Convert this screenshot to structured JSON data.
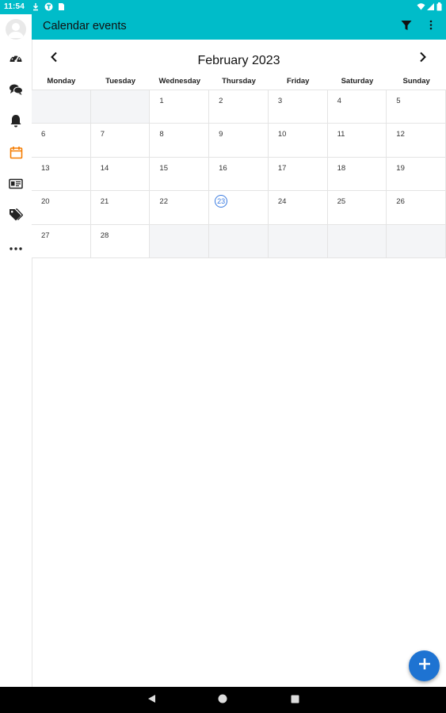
{
  "status_bar": {
    "time": "11:54",
    "icons": [
      "download-icon",
      "vpn-icon",
      "sim-icon",
      "wifi-icon",
      "signal-icon",
      "battery-icon"
    ]
  },
  "sidebar": {
    "items": [
      {
        "name": "avatar"
      },
      {
        "name": "dashboard-icon"
      },
      {
        "name": "chat-icon"
      },
      {
        "name": "bell-icon"
      },
      {
        "name": "calendar-icon",
        "active": true
      },
      {
        "name": "id-card-icon"
      },
      {
        "name": "tags-icon"
      },
      {
        "name": "more-icon"
      }
    ],
    "active_color": "#f57c00",
    "icon_color": "#222222"
  },
  "appbar": {
    "title": "Calendar events",
    "background": "#00bcc9",
    "actions": [
      "filter-icon",
      "more-vert-icon"
    ]
  },
  "calendar": {
    "month_title": "February 2023",
    "weekdays": [
      "Monday",
      "Tuesday",
      "Wednesday",
      "Thursday",
      "Friday",
      "Saturday",
      "Sunday"
    ],
    "weeks": [
      [
        "",
        "",
        "1",
        "2",
        "3",
        "4",
        "5"
      ],
      [
        "6",
        "7",
        "8",
        "9",
        "10",
        "11",
        "12"
      ],
      [
        "13",
        "14",
        "15",
        "16",
        "17",
        "18",
        "19"
      ],
      [
        "20",
        "21",
        "22",
        "23",
        "24",
        "25",
        "26"
      ],
      [
        "27",
        "28",
        "",
        "",
        "",
        "",
        ""
      ]
    ],
    "today": "23",
    "today_color": "#3a7be0"
  },
  "fab": {
    "icon": "plus-icon",
    "color": "#1e73d2"
  },
  "system_nav": [
    "back-icon",
    "home-icon",
    "recents-icon"
  ]
}
